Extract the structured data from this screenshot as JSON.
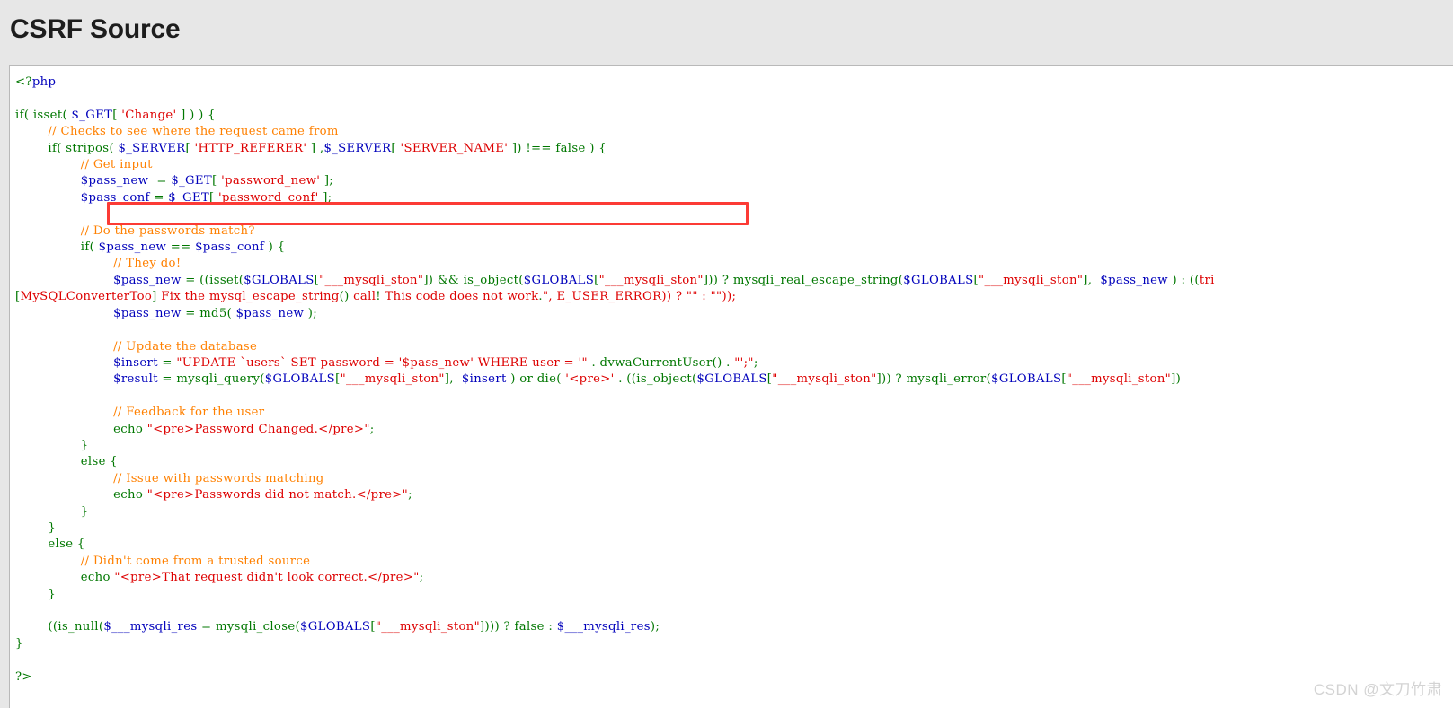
{
  "page": {
    "title": "CSRF Source",
    "watermark": "CSDN @文刀竹肃",
    "background_color": "#e7e7e7",
    "panel_background": "#ffffff",
    "panel_border_color": "#b9b9b9"
  },
  "highlight": {
    "name": "referer-check-highlight",
    "color": "#fc3b35",
    "target_text": "stripos( $_SERVER[ 'HTTP_REFERER' ] ,$_SERVER[ 'SERVER_NAME' ]) !== false ) {"
  },
  "syntax_colors": {
    "keyword": "#007700",
    "variable": "#0000bb",
    "string": "#dd0000",
    "comment": "#ff8000",
    "default": "#000000"
  },
  "code": {
    "language": "php",
    "lines": [
      "<?php",
      "",
      "if( isset( $_GET[ 'Change' ] ) ) {",
      "        // Checks to see where the request came from",
      "        if( stripos( $_SERVER[ 'HTTP_REFERER' ] ,$_SERVER[ 'SERVER_NAME' ]) !== false ) {",
      "                // Get input",
      "                $pass_new  = $_GET[ 'password_new' ];",
      "                $pass_conf = $_GET[ 'password_conf' ];",
      "",
      "                // Do the passwords match?",
      "                if( $pass_new == $pass_conf ) {",
      "                        // They do!",
      "                        $pass_new = ((isset($GLOBALS[\"___mysqli_ston\"]) && is_object($GLOBALS[\"___mysqli_ston\"])) ? mysqli_real_escape_string($GLOBALS[\"___mysqli_ston\"],  $pass_new ) : ((tri",
      "[MySQLConverterToo] Fix the mysql_escape_string() call! This code does not work.\", E_USER_ERROR)) ? \"\" : \"\"));",
      "                        $pass_new = md5( $pass_new );",
      "",
      "                        // Update the database",
      "                        $insert = \"UPDATE `users` SET password = '$pass_new' WHERE user = '\" . dvwaCurrentUser() . \"';\";",
      "                        $result = mysqli_query($GLOBALS[\"___mysqli_ston\"],  $insert ) or die( '<pre>' . ((is_object($GLOBALS[\"___mysqli_ston\"])) ? mysqli_error($GLOBALS[\"___mysqli_ston\"])",
      "",
      "                        // Feedback for the user",
      "                        echo \"<pre>Password Changed.</pre>\";",
      "                }",
      "                else {",
      "                        // Issue with passwords matching",
      "                        echo \"<pre>Passwords did not match.</pre>\";",
      "                }",
      "        }",
      "        else {",
      "                // Didn't come from a trusted source",
      "                echo \"<pre>That request didn't look correct.</pre>\";",
      "        }",
      "",
      "        ((is_null($___mysqli_res = mysqli_close($GLOBALS[\"___mysqli_ston\"]))) ? false : $___mysqli_res);",
      "}",
      "",
      "?>"
    ]
  }
}
